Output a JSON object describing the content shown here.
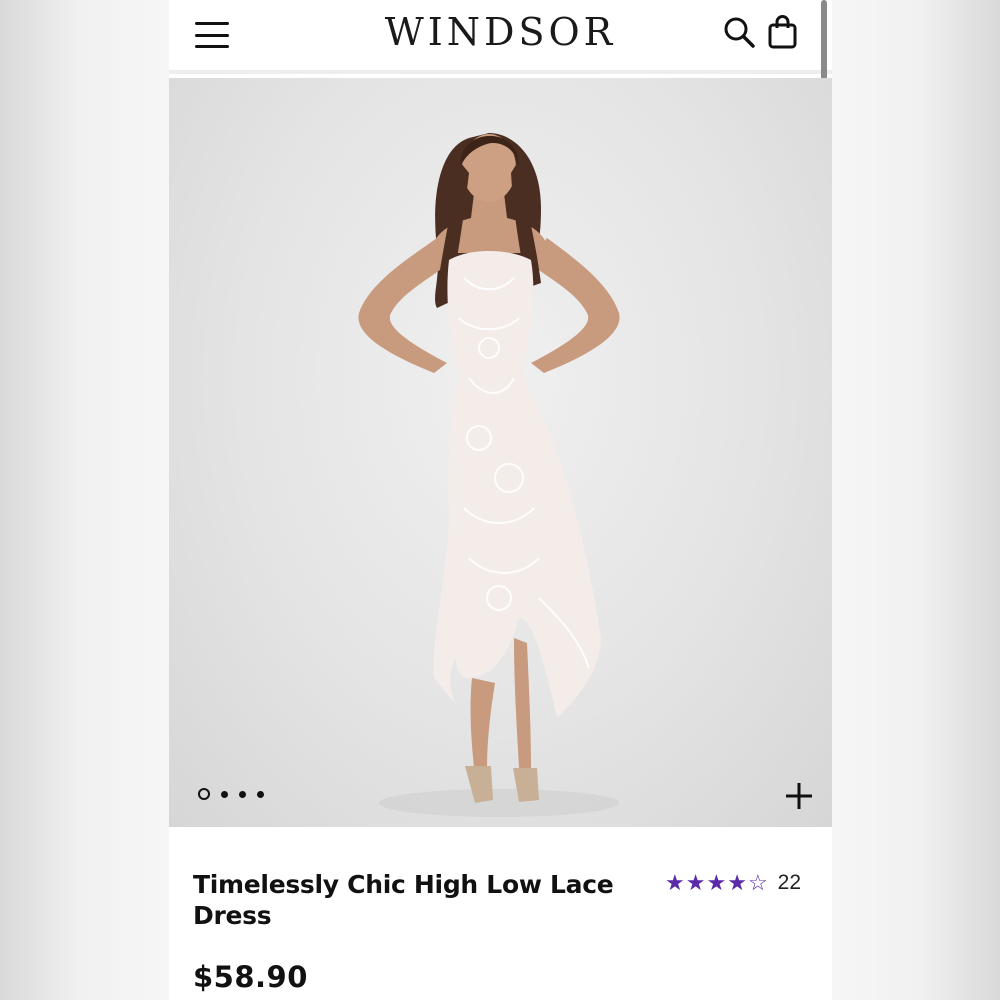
{
  "header": {
    "logo": "WINDSOR",
    "icons": {
      "menu": "hamburger-menu-icon",
      "search": "search-icon",
      "bag": "shopping-bag-icon"
    }
  },
  "gallery": {
    "image_count": 4,
    "active_index": 0,
    "zoom_icon": "plus-icon"
  },
  "product": {
    "title": "Timelessly Chic High Low Lace Dress",
    "rating": 4,
    "rating_max": 5,
    "review_count": "22",
    "price": "$58.90"
  },
  "colors": {
    "star": "#5b2aa8",
    "text": "#111111",
    "hero_bg": "#e4e4e4"
  }
}
